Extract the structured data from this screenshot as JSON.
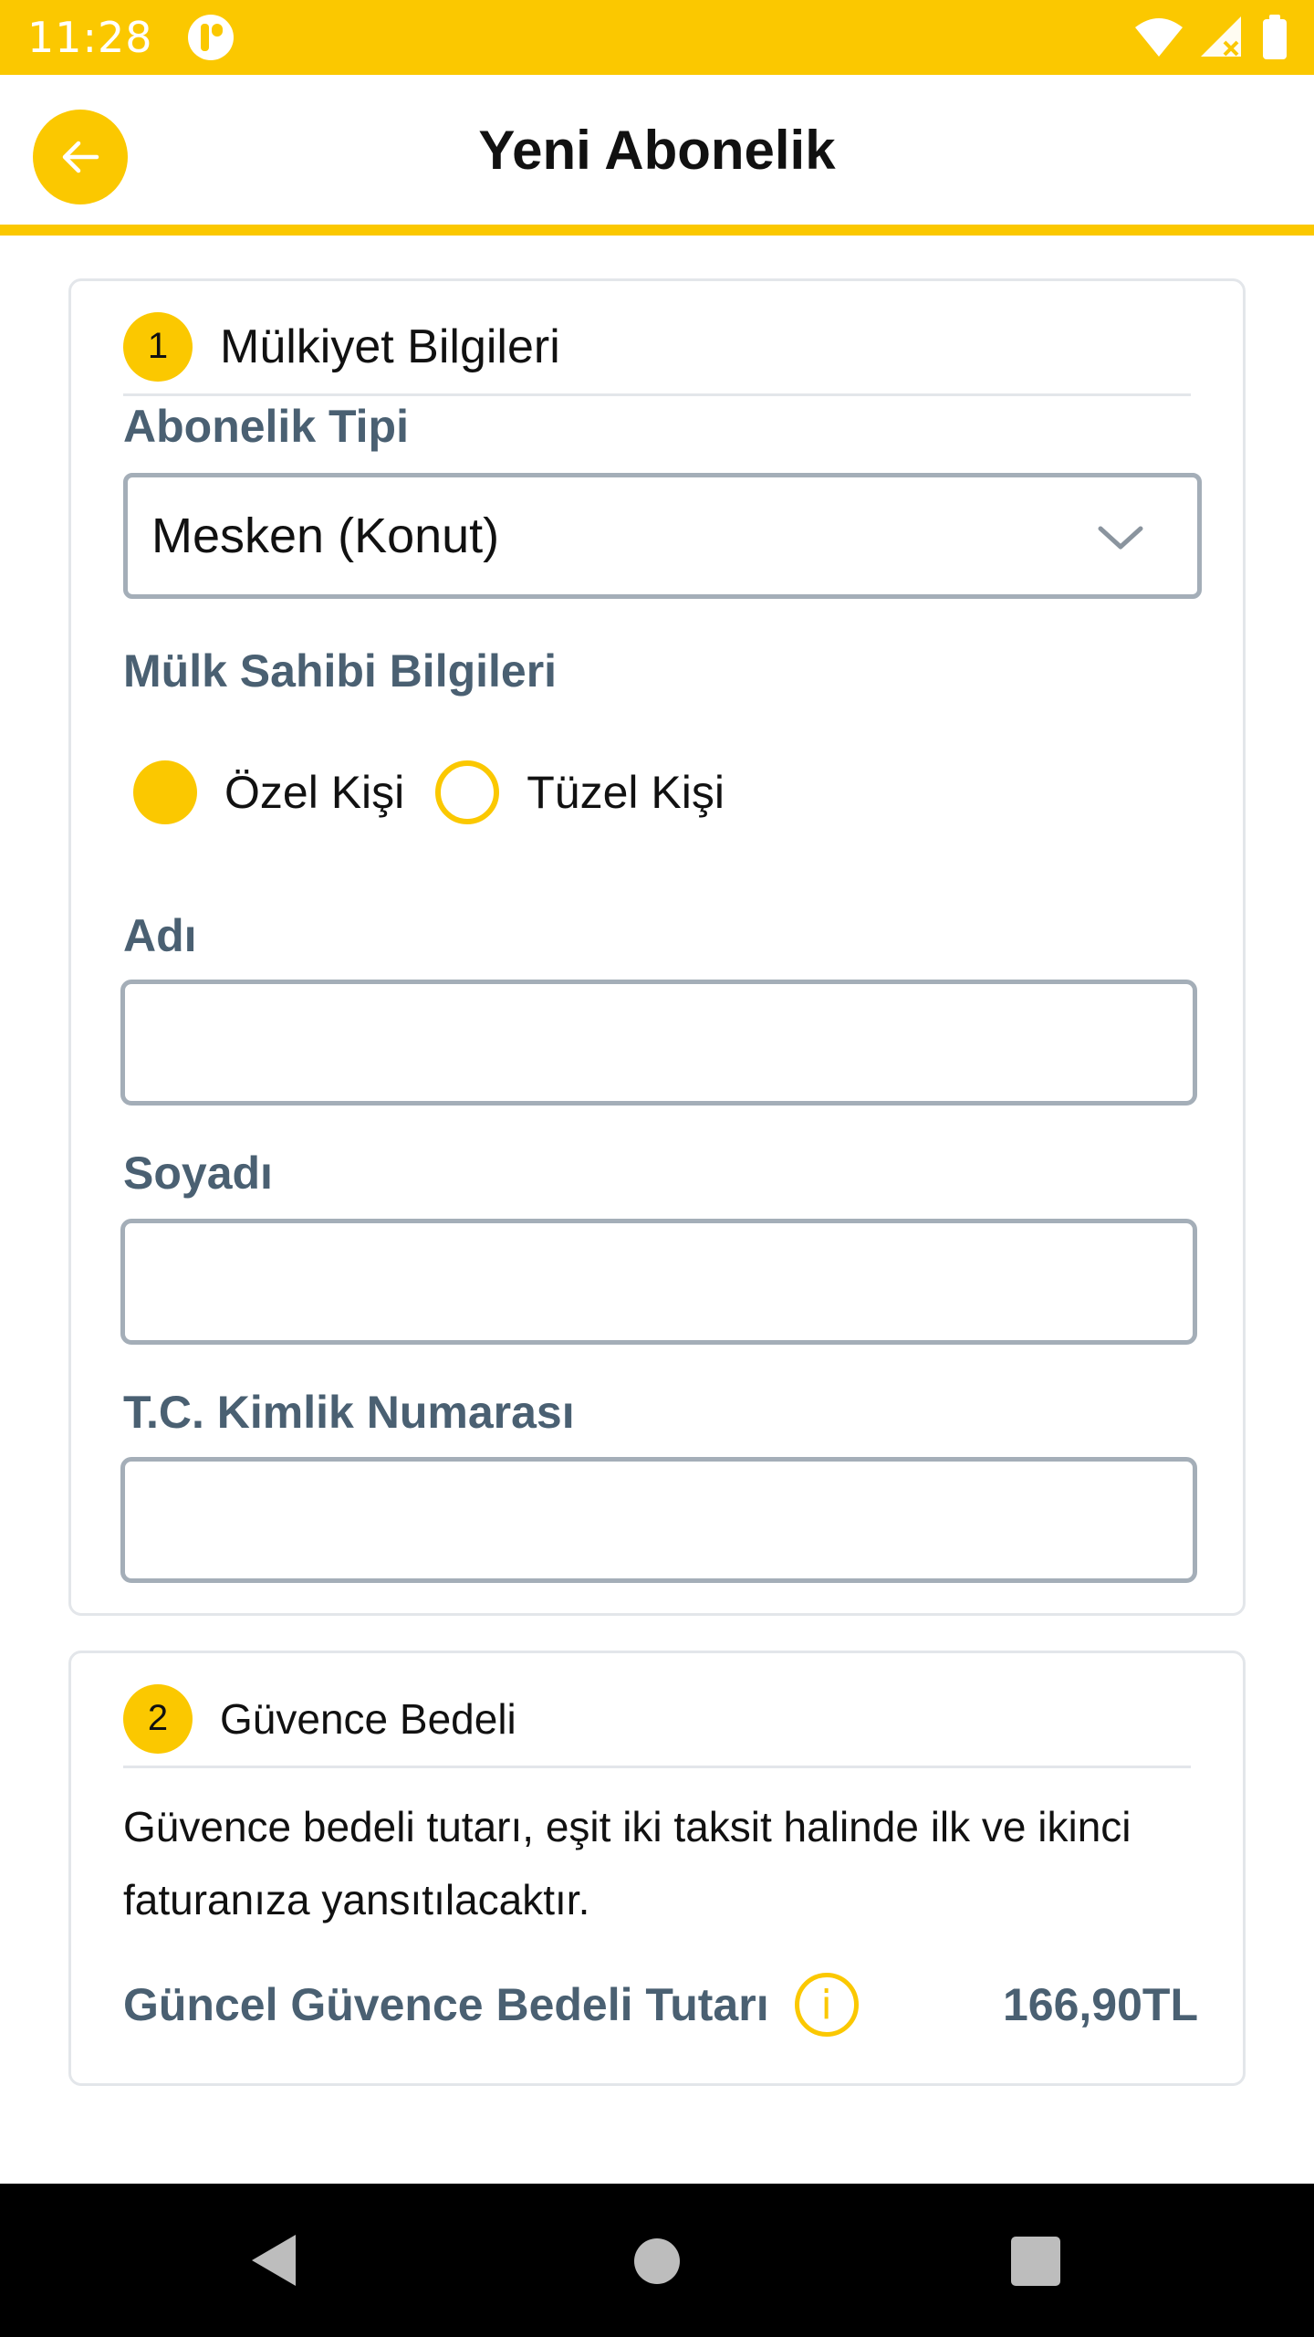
{
  "status_bar": {
    "time": "11:28",
    "icons": [
      "app-notification-icon",
      "wifi-icon",
      "signal-icon",
      "battery-icon"
    ]
  },
  "header": {
    "title": "Yeni Abonelik",
    "back_icon": "arrow-left-icon"
  },
  "section_ownership": {
    "step": "1",
    "title": "Mülkiyet Bilgileri",
    "subscription_type_label": "Abonelik Tipi",
    "subscription_type_value": "Mesken (Konut)",
    "owner_info_label": "Mülk Sahibi Bilgileri",
    "owner_type_options": [
      {
        "label": "Özel Kişi",
        "selected": true
      },
      {
        "label": "Tüzel Kişi",
        "selected": false
      }
    ],
    "first_name_label": "Adı",
    "first_name_value": "",
    "last_name_label": "Soyadı",
    "last_name_value": "",
    "tc_id_label": "T.C. Kimlik Numarası",
    "tc_id_value": ""
  },
  "section_deposit": {
    "step": "2",
    "title": "Güvence Bedeli",
    "description": "Güvence bedeli tutarı, eşit iki taksit halinde ilk ve ikinci faturanıza yansıtılacaktır.",
    "fee_label": "Güncel Güvence Bedeli Tutarı",
    "fee_info_glyph": "i",
    "fee_value": "166,90TL"
  },
  "colors": {
    "brand_yellow": "#fbc800",
    "label_slate": "#4a6072",
    "border_gray": "#a4aeb8"
  }
}
